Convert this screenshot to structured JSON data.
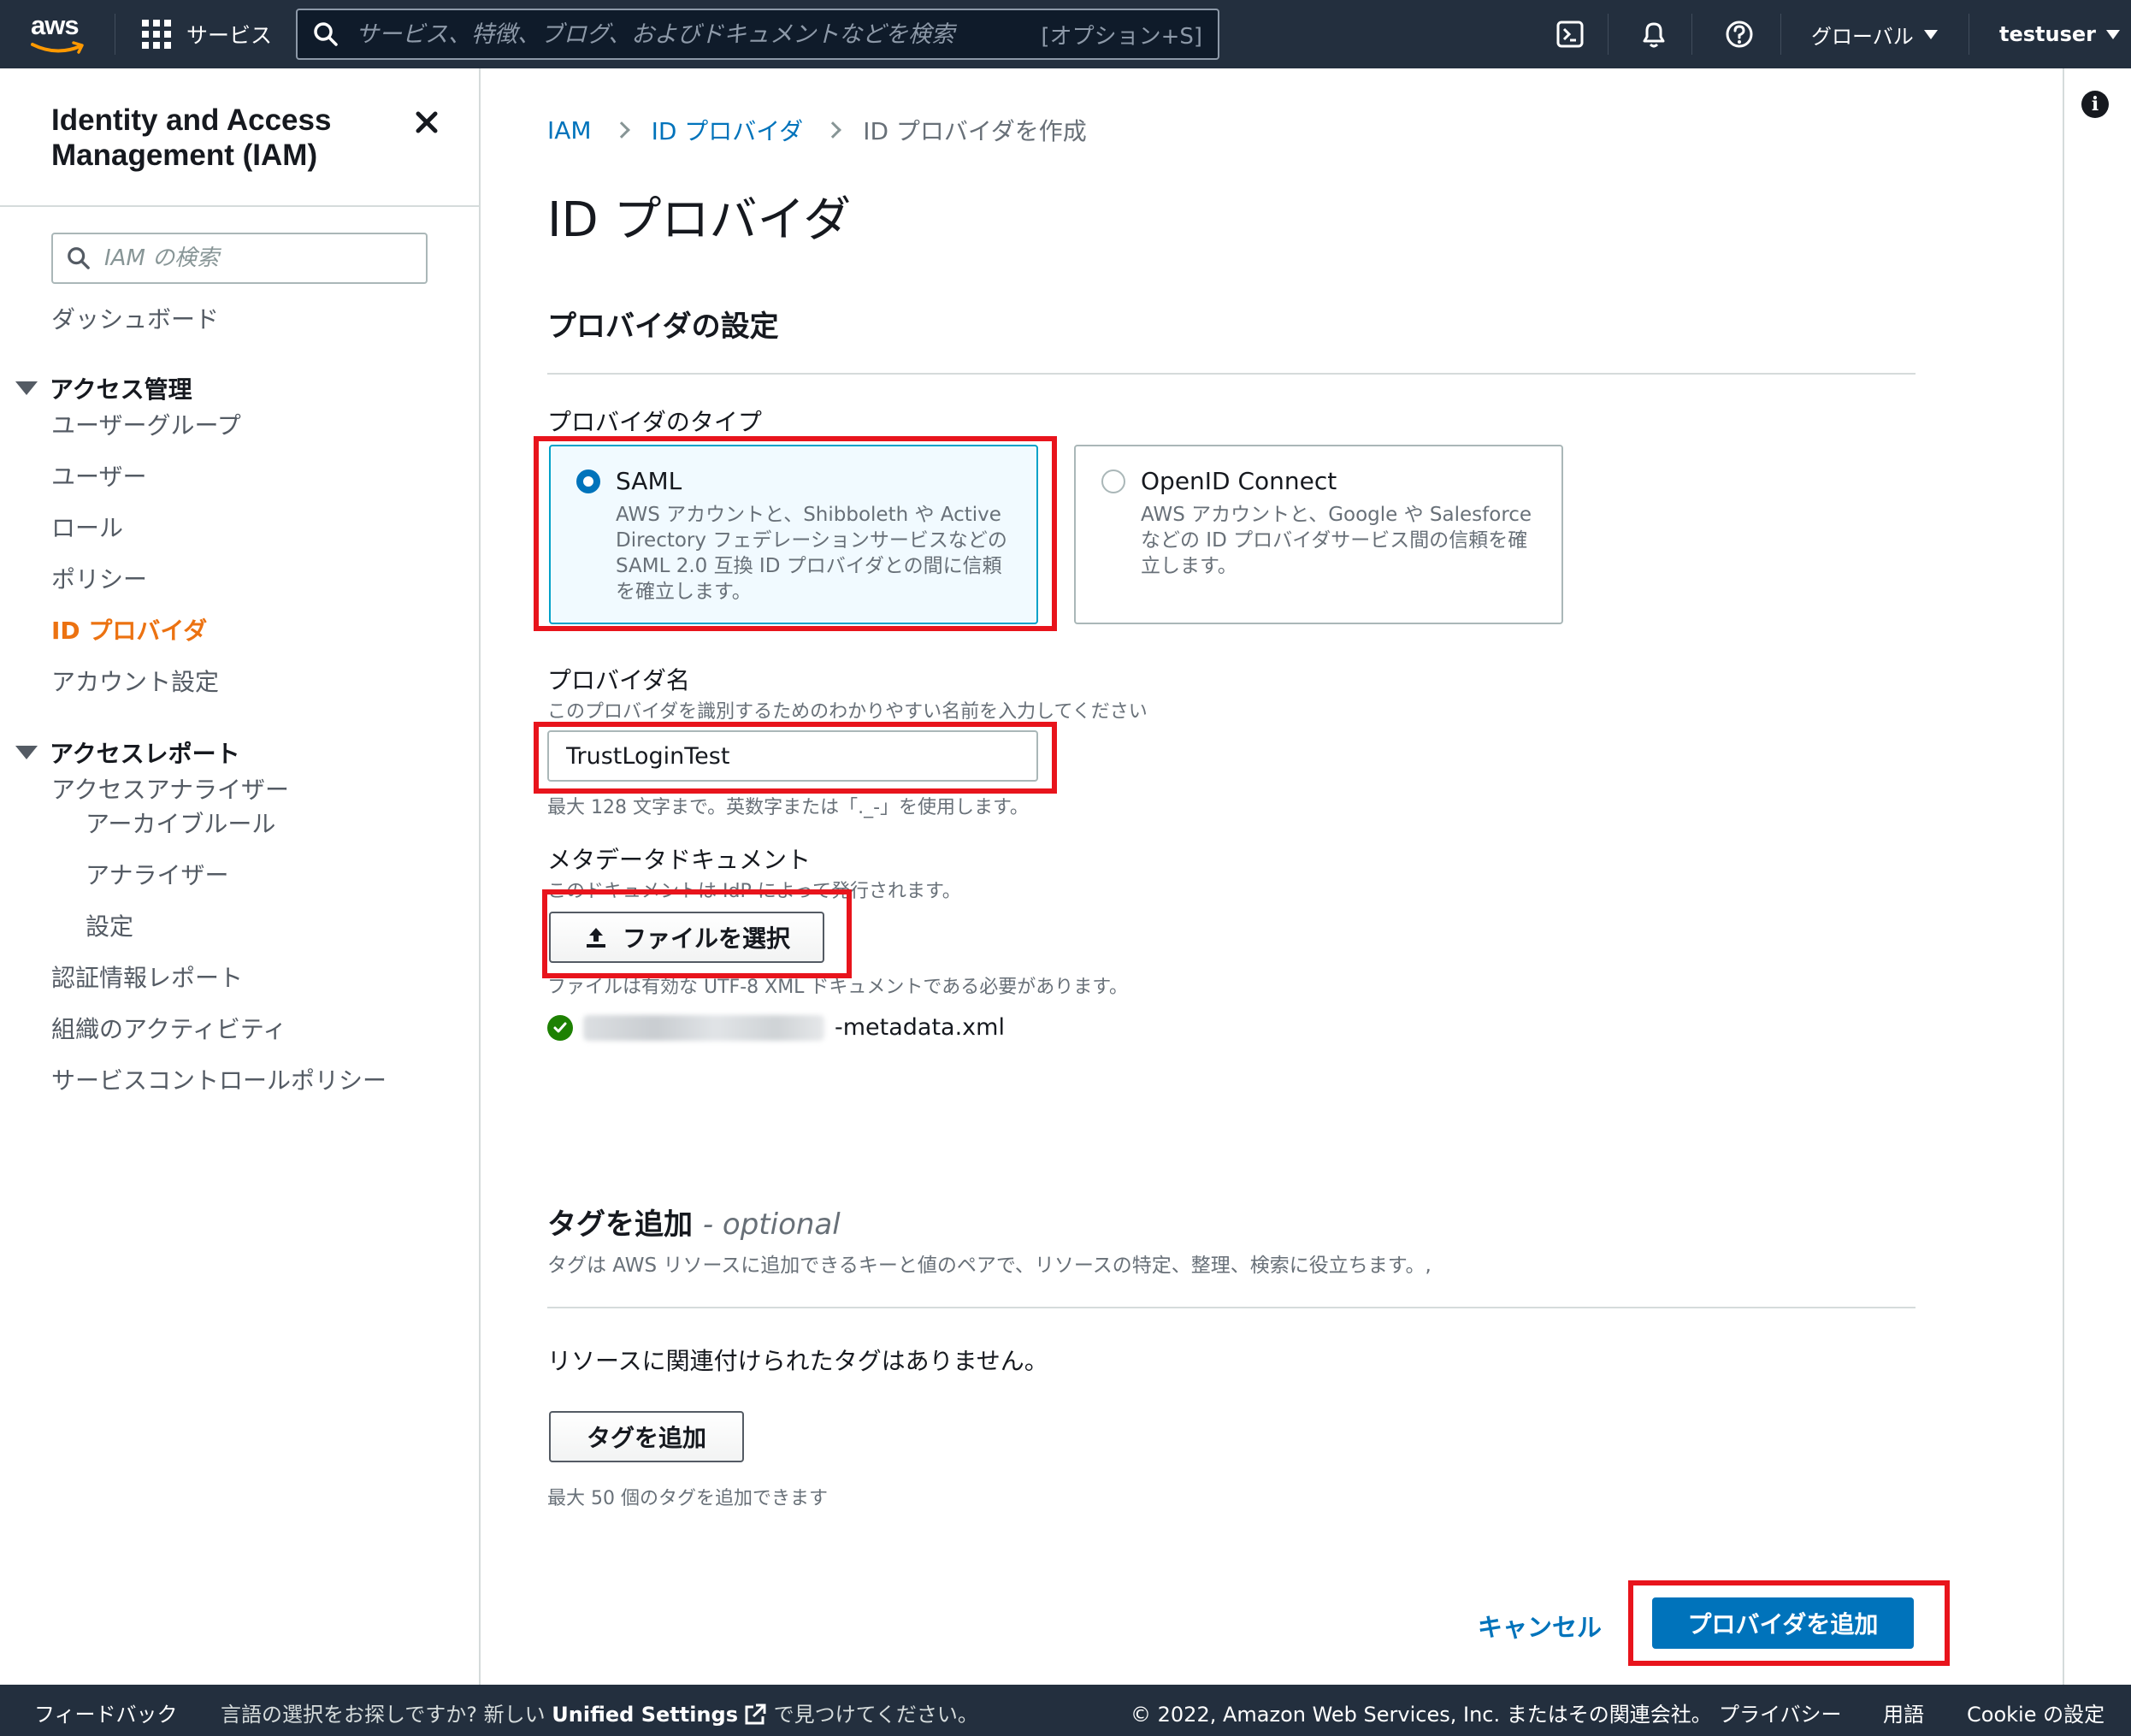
{
  "topbar": {
    "logo_text": "aws",
    "services_label": "サービス",
    "search_placeholder": "サービス、特徴、ブログ、およびドキュメントなどを検索",
    "search_shortcut": "[オプション+S]",
    "region_label": "グローバル",
    "user_label": "testuser"
  },
  "sidebar": {
    "title": "Identity and Access Management (IAM)",
    "search_placeholder": "IAM の検索",
    "dashboard": "ダッシュボード",
    "access_management": {
      "label": "アクセス管理",
      "items": [
        "ユーザーグループ",
        "ユーザー",
        "ロール",
        "ポリシー",
        "ID プロバイダ",
        "アカウント設定"
      ]
    },
    "access_reports": {
      "label": "アクセスレポート",
      "analyzer": "アクセスアナライザー",
      "sub_items": [
        "アーカイブルール",
        "アナライザー",
        "設定"
      ],
      "items": [
        "認証情報レポート",
        "組織のアクティビティ",
        "サービスコントロールポリシー"
      ]
    }
  },
  "breadcrumb": [
    "IAM",
    "ID プロバイダ",
    "ID プロバイダを作成"
  ],
  "page_title": "ID プロバイダ",
  "provider_settings": {
    "heading": "プロバイダの設定",
    "type_label": "プロバイダのタイプ",
    "options": [
      {
        "title": "SAML",
        "description": "AWS アカウントと、Shibboleth や Active Directory フェデレーションサービスなどの SAML 2.0 互換 ID プロバイダとの間に信頼を確立します。",
        "selected": true
      },
      {
        "title": "OpenID Connect",
        "description": "AWS アカウントと、Google や Salesforce などの ID プロバイダサービス間の信頼を確立します。",
        "selected": false
      }
    ],
    "name_label": "プロバイダ名",
    "name_description": "このプロバイダを識別するためのわかりやすい名前を入力してください",
    "name_value": "TrustLoginTest",
    "name_constraint": "最大 128 文字まで。英数字または「._-」を使用します。",
    "metadata_label": "メタデータドキュメント",
    "metadata_description": "このドキュメントは IdP によって発行されます。",
    "choose_file_label": "ファイルを選択",
    "file_constraint": "ファイルは有効な UTF-8 XML ドキュメントである必要があります。",
    "file_name_suffix": "-metadata.xml"
  },
  "tags": {
    "heading": "タグを追加",
    "optional": "- optional",
    "description": "タグは AWS リソースに追加できるキーと値のペアで、リソースの特定、整理、検索に役立ちます。,",
    "empty_text": "リソースに関連付けられたタグはありません。",
    "add_button": "タグを追加",
    "limit_text": "最大 50 個のタグを追加できます"
  },
  "actions": {
    "cancel": "キャンセル",
    "submit": "プロバイダを追加"
  },
  "footer": {
    "feedback": "フィードバック",
    "language_prefix": "言語の選択をお探しですか? 新しい",
    "unified_settings": "Unified Settings",
    "language_suffix": "で見つけてください。",
    "copyright": "© 2022, Amazon Web Services, Inc. またはその関連会社。",
    "privacy": "プライバシー",
    "terms": "用語",
    "cookie": "Cookie の設定"
  },
  "colors": {
    "nav_background": "#232f3e",
    "link_blue": "#0073bb",
    "active_orange": "#ec7211",
    "success_green": "#1d8102",
    "annotation_red": "#e8141c"
  }
}
